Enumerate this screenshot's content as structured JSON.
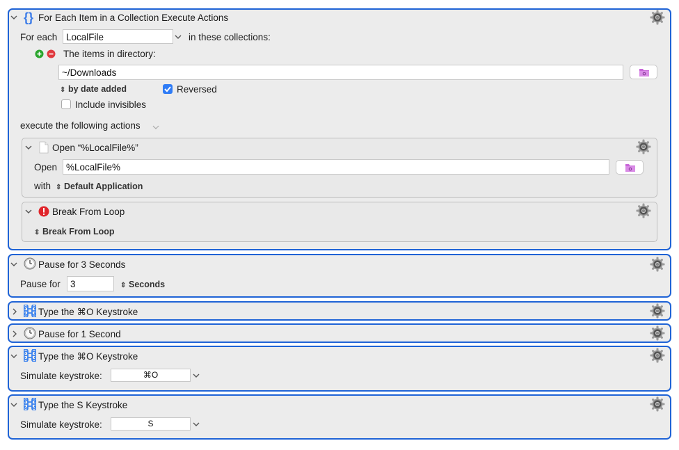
{
  "for_each": {
    "title": "For Each Item in a Collection Execute Actions",
    "for_each_label": "For each",
    "variable_value": "LocalFile",
    "in_collections_label": "in these collections:",
    "collection_label": "The items in directory:",
    "directory_value": "~/Downloads",
    "sort_label": "by date added",
    "reversed_label": "Reversed",
    "reversed_checked": true,
    "include_invisibles_label": "Include invisibles",
    "include_invisibles_checked": false,
    "execute_label": "execute the following actions"
  },
  "open_action": {
    "title": "Open “%LocalFile%”",
    "open_label": "Open",
    "open_value": "%LocalFile%",
    "with_label": "with",
    "app_value": "Default Application"
  },
  "break_action": {
    "title": "Break From Loop",
    "option_value": "Break From Loop"
  },
  "pause3": {
    "title": "Pause for 3 Seconds",
    "pause_label": "Pause for",
    "value": "3",
    "unit": "Seconds"
  },
  "type_cmd_o_collapsed": {
    "title": "Type the ⌘O Keystroke"
  },
  "pause1": {
    "title": "Pause for 1 Second"
  },
  "type_cmd_o": {
    "title": "Type the ⌘O Keystroke",
    "simulate_label": "Simulate keystroke:",
    "keystroke_value": "⌘O"
  },
  "type_s": {
    "title": "Type the S Keystroke",
    "simulate_label": "Simulate keystroke:",
    "keystroke_value": "S"
  },
  "colors": {
    "accent_border": "#1f63d6",
    "checkbox_blue": "#2f7cf6",
    "folder_icon": "#c864d8",
    "add_green": "#2aa52d",
    "remove_red": "#e0393e"
  },
  "icons": {
    "collapse": "chevron-down-icon",
    "expand": "chevron-right-icon",
    "gear": "gear-icon",
    "braces": "braces-icon",
    "document": "document-icon",
    "stop": "stop-icon",
    "clock": "clock-icon",
    "command": "command-icon",
    "folder": "folder-icon"
  }
}
